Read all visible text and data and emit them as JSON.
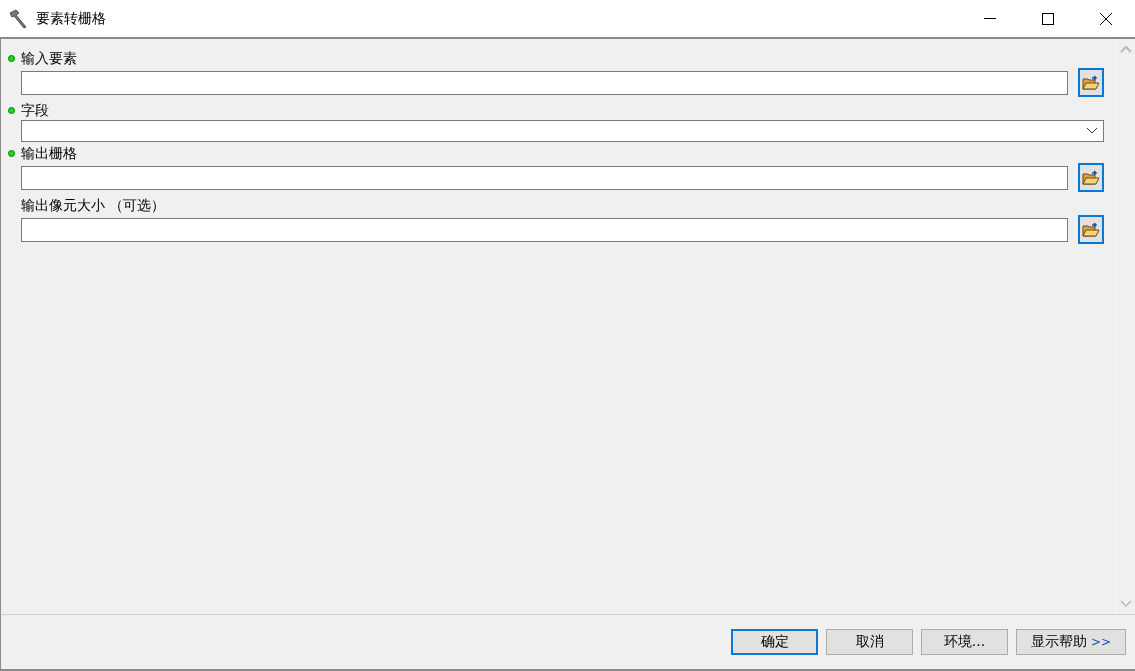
{
  "window": {
    "title": "要素转栅格"
  },
  "parameters": [
    {
      "label": "输入要素",
      "required": true,
      "kind": "file"
    },
    {
      "label": "字段",
      "required": true,
      "kind": "dropdown"
    },
    {
      "label": "输出栅格",
      "required": true,
      "kind": "file"
    },
    {
      "label": "输出像元大小 （可选）",
      "required": false,
      "kind": "file"
    }
  ],
  "buttons": [
    {
      "label": "确定",
      "default": true
    },
    {
      "label": "取消",
      "default": false
    },
    {
      "label": "环境...",
      "default": false
    },
    {
      "label": "显示帮助",
      "default": false,
      "suffix": ">>"
    }
  ]
}
